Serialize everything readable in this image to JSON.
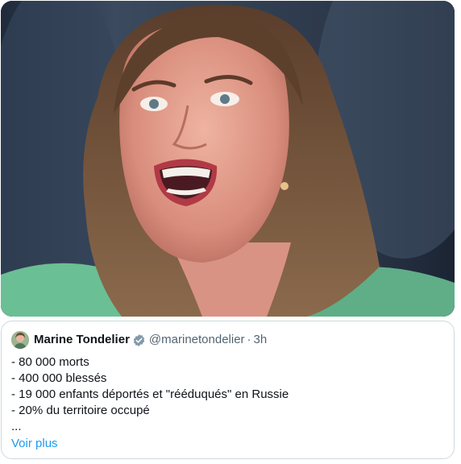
{
  "quote": {
    "author": {
      "name": "Marine Tondelier",
      "handle": "@marinetondelier",
      "separator": "·",
      "time": "3h",
      "verified_color": "#829aab"
    },
    "lines": [
      "- 80 000 morts",
      "- 400 000 blessés",
      "- 19 000 enfants déportés et \"rééduqués\" en Russie",
      "- 20% du territoire occupé",
      "..."
    ],
    "more_label": "Voir plus",
    "link_color": "#1d9bf0"
  },
  "media": {
    "icon": "photo-image"
  }
}
